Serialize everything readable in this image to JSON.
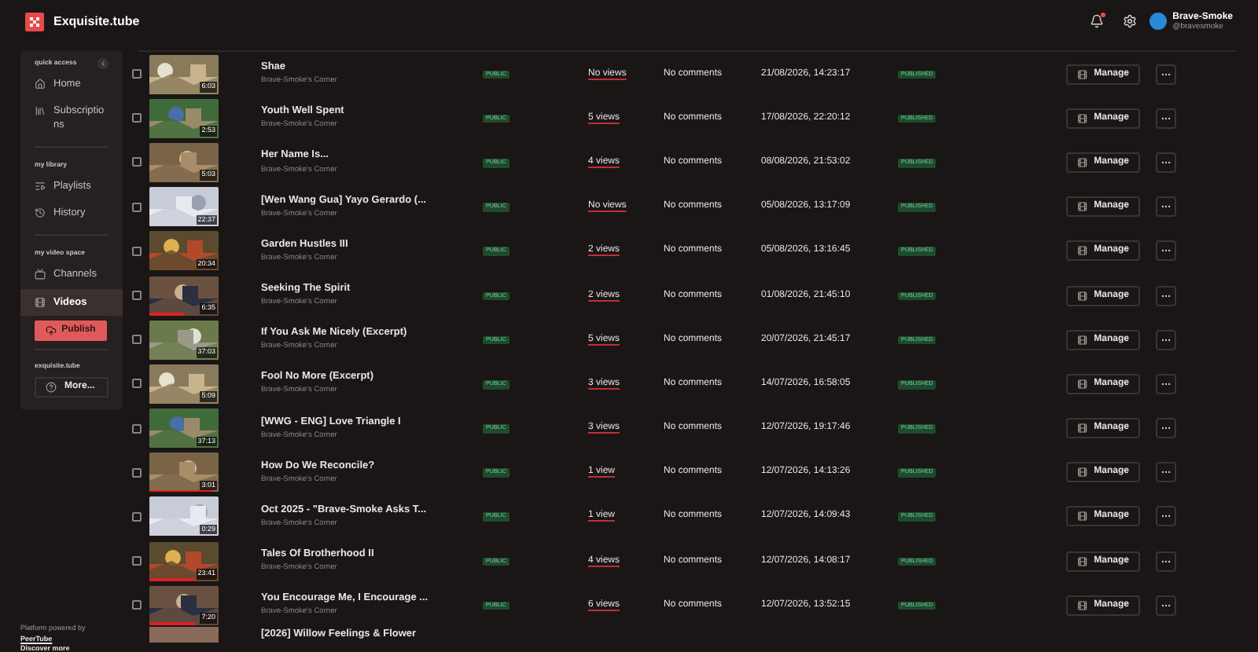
{
  "header": {
    "site_name": "Exquisite.tube",
    "notification_unread": true,
    "user": {
      "name": "Brave-Smoke",
      "handle": "@bravesmoke"
    }
  },
  "sidebar": {
    "sections": [
      {
        "heading": "quick access",
        "collapsible": true,
        "items": [
          {
            "label": "Home",
            "kind": "home",
            "selected": false
          },
          {
            "label": "Subscriptions",
            "kind": "subscriptions",
            "selected": false
          }
        ]
      },
      {
        "heading": "my library",
        "items": [
          {
            "label": "Playlists",
            "kind": "playlists",
            "selected": false
          },
          {
            "label": "History",
            "kind": "history",
            "selected": false
          }
        ]
      },
      {
        "heading": "my video space",
        "items": [
          {
            "label": "Channels",
            "kind": "channels",
            "selected": false
          },
          {
            "label": "Videos",
            "kind": "videos",
            "selected": true
          }
        ],
        "button": "Publish"
      },
      {
        "heading": "exquisite.tube",
        "more_button": "More..."
      }
    ],
    "footer": [
      "Platform powered by",
      "PeerTube",
      "Discover more"
    ]
  },
  "videos": [
    {
      "title": "Shae",
      "channel": "Brave-Smoke's Corner",
      "duration": "6:03",
      "privacy": "PUBLIC",
      "views": "No views",
      "comments": "No comments",
      "date": "21/08/2026, 14:23:17",
      "state": "PUBLISHED",
      "manage": "Manage",
      "checked": false
    },
    {
      "title": "Youth Well Spent",
      "channel": "Brave-Smoke's Corner",
      "duration": "2:53",
      "privacy": "PUBLIC",
      "views": "5 views",
      "comments": "No comments",
      "date": "17/08/2026, 22:20:12",
      "state": "PUBLISHED",
      "manage": "Manage",
      "checked": false
    },
    {
      "title": "Her Name Is...",
      "channel": "Brave-Smoke's Corner",
      "duration": "5:03",
      "privacy": "PUBLIC",
      "views": "4 views",
      "comments": "No comments",
      "date": "08/08/2026, 21:53:02",
      "state": "PUBLISHED",
      "manage": "Manage",
      "checked": false
    },
    {
      "title": "[Wen Wang Gua] Yayo Gerardo (...",
      "channel": "Brave-Smoke's Corner",
      "duration": "22:37",
      "privacy": "PUBLIC",
      "views": "No views",
      "comments": "No comments",
      "date": "05/08/2026, 13:17:09",
      "state": "PUBLISHED",
      "manage": "Manage",
      "checked": false
    },
    {
      "title": "Garden Hustles III",
      "channel": "Brave-Smoke's Corner",
      "duration": "20:34",
      "privacy": "PUBLIC",
      "views": "2 views",
      "comments": "No comments",
      "date": "05/08/2026, 13:16:45",
      "state": "PUBLISHED",
      "manage": "Manage",
      "checked": false
    },
    {
      "title": "Seeking The Spirit",
      "channel": "Brave-Smoke's Corner",
      "duration": "6:35",
      "level": 0.5,
      "privacy": "PUBLIC",
      "views": "2 views",
      "comments": "No comments",
      "date": "01/08/2026, 21:45:10",
      "state": "PUBLISHED",
      "manage": "Manage",
      "checked": false
    },
    {
      "title": "If You Ask Me Nicely (Excerpt)",
      "channel": "Brave-Smoke's Corner",
      "duration": "37:03",
      "privacy": "PUBLIC",
      "views": "5 views",
      "comments": "No comments",
      "date": "20/07/2026, 21:45:17",
      "state": "PUBLISHED",
      "manage": "Manage",
      "checked": false
    },
    {
      "title": "Fool No More (Excerpt)",
      "channel": "Brave-Smoke's Corner",
      "duration": "5:09",
      "privacy": "PUBLIC",
      "views": "3 views",
      "comments": "No comments",
      "date": "14/07/2026, 16:58:05",
      "state": "PUBLISHED",
      "manage": "Manage",
      "checked": false
    },
    {
      "title": "[WWG - ENG] Love Triangle I",
      "channel": "Brave-Smoke's Corner",
      "duration": "37:13",
      "privacy": "PUBLIC",
      "views": "3 views",
      "comments": "No comments",
      "date": "12/07/2026, 19:17:46",
      "state": "PUBLISHED",
      "manage": "Manage",
      "checked": false
    },
    {
      "title": "How Do We Reconcile?",
      "channel": "Brave-Smoke's Corner",
      "duration": "3:01",
      "level": 0.9,
      "privacy": "PUBLIC",
      "views": "1 view",
      "comments": "No comments",
      "date": "12/07/2026, 14:13:26",
      "state": "PUBLISHED",
      "manage": "Manage",
      "checked": false
    },
    {
      "title": "Oct 2025 - \"Brave-Smoke Asks T...",
      "channel": "Brave-Smoke's Corner",
      "duration": "0:29",
      "privacy": "PUBLIC",
      "views": "1 view",
      "comments": "No comments",
      "date": "12/07/2026, 14:09:43",
      "state": "PUBLISHED",
      "manage": "Manage",
      "checked": false
    },
    {
      "title": "Tales Of Brotherhood II",
      "channel": "Brave-Smoke's Corner",
      "duration": "23:41",
      "level": 0.65,
      "privacy": "PUBLIC",
      "views": "4 views",
      "comments": "No comments",
      "date": "12/07/2026, 14:08:17",
      "state": "PUBLISHED",
      "manage": "Manage",
      "checked": false
    },
    {
      "title": "You Encourage Me, I Encourage ...",
      "channel": "Brave-Smoke's Corner",
      "duration": "7:20",
      "level": 0.65,
      "privacy": "PUBLIC",
      "views": "6 views",
      "comments": "No comments",
      "date": "12/07/2026, 13:52:15",
      "state": "PUBLISHED",
      "manage": "Manage",
      "checked": false
    }
  ],
  "partial_row": {
    "title": "[2026] Willow Feelings & Flower"
  }
}
